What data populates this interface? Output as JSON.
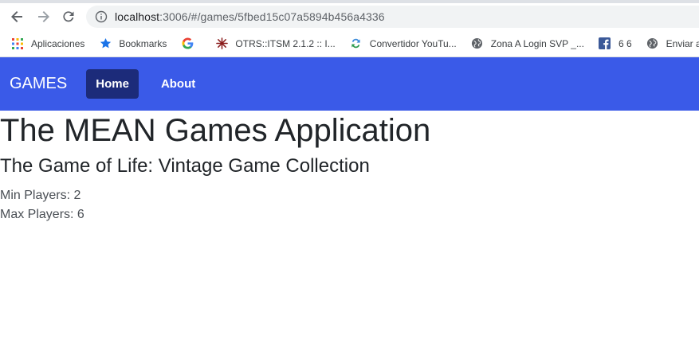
{
  "browser": {
    "url_host": "localhost",
    "url_path": ":3006/#/games/5fbed15c07a5894b456a4336",
    "bookmarks": [
      {
        "label": "Aplicaciones",
        "icon": "apps-grid-icon"
      },
      {
        "label": "Bookmarks",
        "icon": "star-icon"
      },
      {
        "label": "",
        "icon": "google-icon"
      },
      {
        "label": "OTRS::ITSM 2.1.2 :: I...",
        "icon": "otrs-icon"
      },
      {
        "label": "Convertidor YouTu...",
        "icon": "convert-icon"
      },
      {
        "label": "Zona A Login SVP _...",
        "icon": "globe-icon"
      },
      {
        "label": "6 6",
        "icon": "facebook-icon"
      },
      {
        "label": "Enviar al Mendeley",
        "icon": "globe-icon"
      }
    ]
  },
  "navbar": {
    "brand": "GAMES",
    "links": [
      {
        "label": "Home",
        "active": true
      },
      {
        "label": "About",
        "active": false
      }
    ],
    "color": "#3a5ae8",
    "active_color": "#1c2b7a"
  },
  "main": {
    "title": "The MEAN Games Application",
    "game_title": "The Game of Life: Vintage Game Collection",
    "min_players": "Min Players: 2",
    "max_players": "Max Players: 6"
  }
}
